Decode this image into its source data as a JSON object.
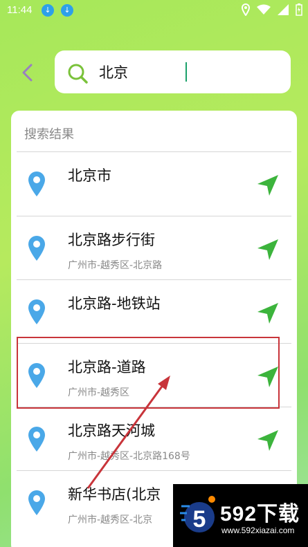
{
  "status": {
    "time": "11:44"
  },
  "search": {
    "value": "北京"
  },
  "results": {
    "title": "搜索结果",
    "items": [
      {
        "name": "北京市",
        "address": ""
      },
      {
        "name": "北京路步行街",
        "address": "广州市-越秀区-北京路"
      },
      {
        "name": "北京路-地铁站",
        "address": ""
      },
      {
        "name": "北京路-道路",
        "address": "广州市-越秀区"
      },
      {
        "name": "北京路天河城",
        "address": "广州市-越秀区-北京路168号"
      },
      {
        "name": "新华书店(北京",
        "address": "广州市-越秀区-北京"
      }
    ]
  },
  "watermark": {
    "title": "592下载",
    "url": "www.592xiazai.com"
  },
  "colors": {
    "accent": "#3cb43c",
    "pin": "#4aa8e8",
    "highlight": "#c8343a"
  }
}
